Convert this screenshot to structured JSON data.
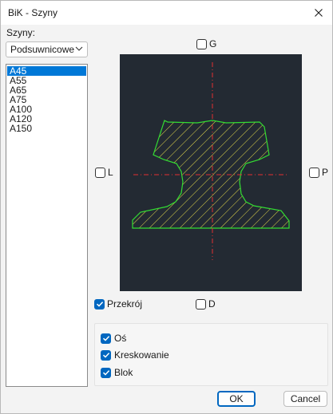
{
  "window": {
    "title": "BiK - Szyny"
  },
  "left": {
    "label": "Szyny:",
    "dropdown_value": "Podsuwnicowe",
    "items": [
      "A45",
      "A55",
      "A65",
      "A75",
      "A100",
      "A120",
      "A150"
    ],
    "selected": "A45"
  },
  "view": {
    "top_checkbox": {
      "label": "G",
      "checked": false
    },
    "left_checkbox": {
      "label": "L",
      "checked": false
    },
    "right_checkbox": {
      "label": "P",
      "checked": false
    },
    "bottom_checkbox": {
      "label": "D",
      "checked": false
    },
    "section_checkbox": {
      "label": "Przekrój",
      "checked": true
    },
    "background": "#232a33",
    "outline_color": "#33dd33",
    "hatch_color": "#e3d84a",
    "axis_color": "#e03030"
  },
  "options": {
    "axis": {
      "label": "Oś",
      "checked": true
    },
    "hatching": {
      "label": "Kreskowanie",
      "checked": true
    },
    "block": {
      "label": "Blok",
      "checked": true
    }
  },
  "buttons": {
    "ok": "OK",
    "cancel": "Cancel"
  }
}
